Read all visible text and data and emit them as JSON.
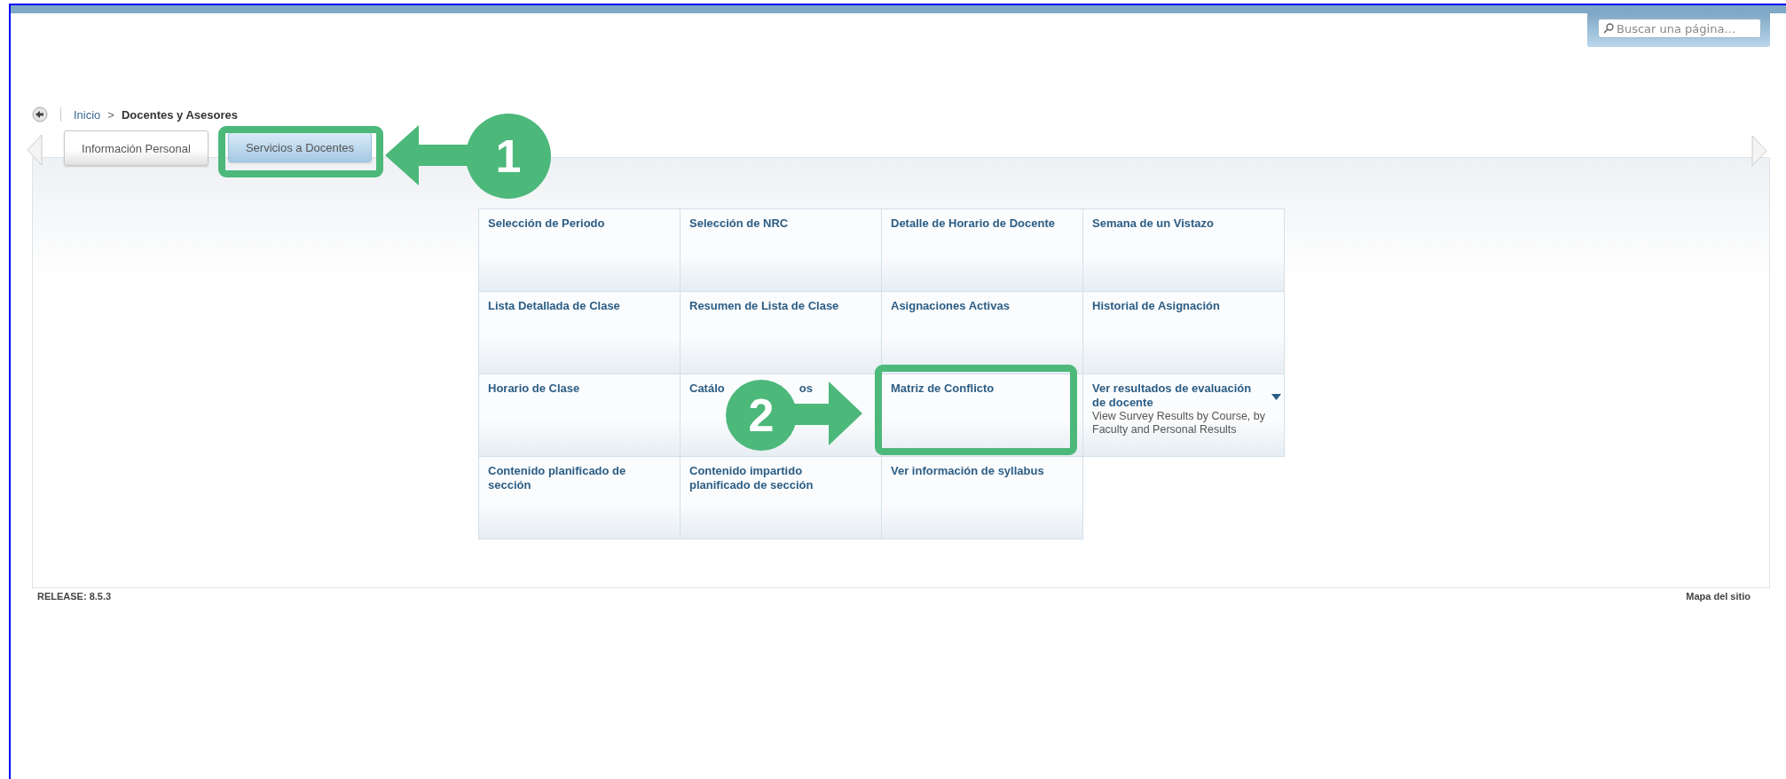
{
  "search": {
    "placeholder": "Buscar una página..."
  },
  "breadcrumb": [
    {
      "label": "Inicio",
      "kind": "link"
    },
    {
      "label": "Docentes y Asesores",
      "kind": "current",
      "separator": ">"
    }
  ],
  "tabs": [
    {
      "label": "Información Personal",
      "selected": false
    },
    {
      "label": "Servicios a Docentes",
      "selected": true
    }
  ],
  "tiles": [
    {
      "title": "Selección de Periodo",
      "kind": "link"
    },
    {
      "title": "Selección de NRC",
      "kind": "link"
    },
    {
      "title": "Detalle de Horario de Docente",
      "kind": "link"
    },
    {
      "title": "Semana de un Vistazo",
      "kind": "link"
    },
    {
      "title": "Lista Detallada de Clase",
      "kind": "link"
    },
    {
      "title": "Resumen de Lista de Clase",
      "kind": "link"
    },
    {
      "title": "Asignaciones Activas",
      "kind": "link"
    },
    {
      "title": "Historial de Asignación",
      "kind": "link"
    },
    {
      "title": "Horario de Clase",
      "kind": "link"
    },
    {
      "title": "Catálo",
      "title_end": "os",
      "kind": "link"
    },
    {
      "title": "Matriz de Conflicto",
      "kind": "link"
    },
    {
      "title": "Ver resultados de evaluación de docente",
      "subtitle": "View Survey Results by Course, by Faculty and Personal Results",
      "kind": "menu"
    },
    {
      "title": "Contenido planificado de sección",
      "kind": "link"
    },
    {
      "title": "Contenido impartido planificado de sección",
      "kind": "link"
    },
    {
      "title": "Ver información de syllabus",
      "kind": "link"
    }
  ],
  "footer": {
    "release": "RELEASE: 8.5.3",
    "site_map": "Mapa del sitio"
  },
  "annotations": [
    {
      "number": "1"
    },
    {
      "number": "2"
    }
  ]
}
